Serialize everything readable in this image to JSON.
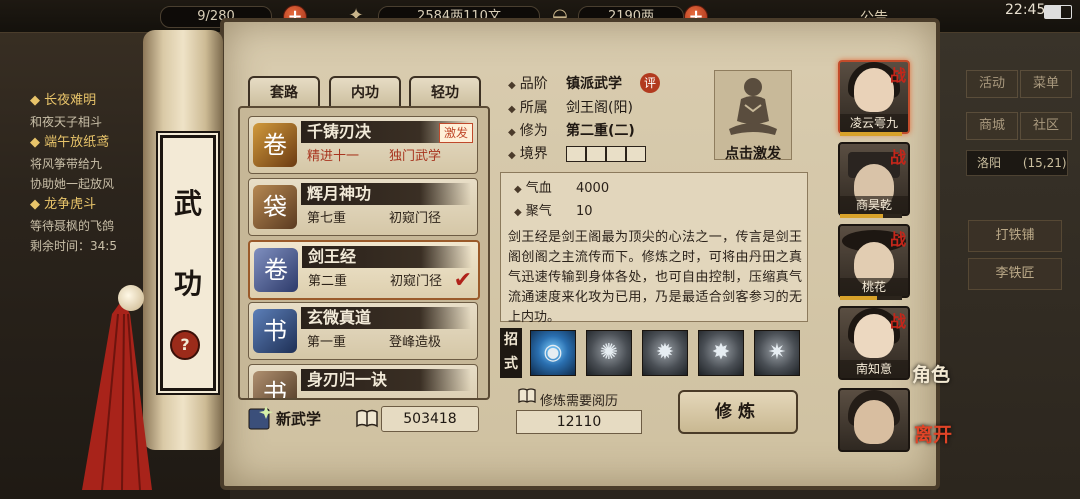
{
  "topbar": {
    "res1": "9/280",
    "res2": "2584两110文",
    "res3": "2190两",
    "announce": "公告",
    "clock": "22:45"
  },
  "quests": [
    {
      "title": "长夜难明",
      "line": "和夜天子相斗"
    },
    {
      "title": "端午放纸鸢",
      "lines": [
        "将风筝带给九",
        "协助她一起放风"
      ]
    },
    {
      "title": "龙争虎斗",
      "lines": [
        "等待聂枫的飞鸽",
        "剩余时间：34:5"
      ]
    }
  ],
  "side": {
    "activity": "活动",
    "menu": "菜单",
    "shop": "商城",
    "community": "社区",
    "location_name": "洛阳",
    "location_coord": "(15,21)",
    "npc1": "打铁铺",
    "npc2": "李铁匠"
  },
  "scroll": {
    "char1": "武",
    "char2": "功",
    "help": "?"
  },
  "tabs": {
    "routine": "套路",
    "inner": "内功",
    "light": "轻功"
  },
  "skills": [
    {
      "name": "千铸刃决",
      "level": "精进十一",
      "rank": "独门武学",
      "badge": "激发"
    },
    {
      "name": "辉月神功",
      "level": "第七重",
      "rank": "初窥门径"
    },
    {
      "name": "剑王经",
      "level": "第二重",
      "rank": "初窥门径"
    },
    {
      "name": "玄微真道",
      "level": "第一重",
      "rank": "登峰造极"
    },
    {
      "name": "身刃归一诀"
    }
  ],
  "footer": {
    "new_skill": "新武学",
    "points": "503418"
  },
  "detail": {
    "grade_label": "品阶",
    "grade_val": "镇派武学",
    "rating": "评",
    "sect_label": "所属",
    "sect_val": "剑王阁(阳)",
    "cult_label": "修为",
    "cult_val": "第二重(二)",
    "realm_label": "境界",
    "portrait_label": "点击激发",
    "hp_label": "气血",
    "hp_val": "4000",
    "qi_label": "聚气",
    "qi_val": "10",
    "description": "剑王经是剑王阁最为顶尖的心法之一，传言是剑王阁创阁之主流传而下。修炼之时，可将由丹田之真气迅速传输到身体各处，也可自由控制，压缩真气流通速度来化攻为已用，乃是最适合剑客参习的无上内功。",
    "moves_label": "招式",
    "req_label": "修炼需要阅历",
    "req_val": "12110",
    "train": "修炼"
  },
  "characters": [
    {
      "name": "凌云雩九",
      "tag": "战"
    },
    {
      "name": "商昊乾",
      "tag": "战"
    },
    {
      "name": "桃花",
      "tag": "战"
    },
    {
      "name": "南知意",
      "tag": "战"
    }
  ],
  "char_hp": [
    1.0,
    0.7,
    0.6,
    1.0
  ],
  "labels": {
    "role": "角色",
    "leave": "离开"
  },
  "colors": {
    "accent_red": "#c4261a",
    "gold": "#e8c46a",
    "parchment": "#d9ccaf"
  }
}
